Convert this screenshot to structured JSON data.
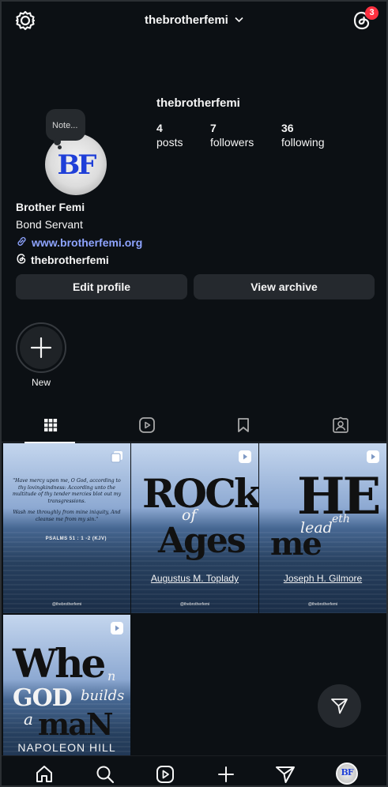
{
  "header": {
    "username": "thebrotherfemi",
    "notification_count": "3"
  },
  "note": {
    "text": "Note..."
  },
  "avatar": {
    "initials": "BF"
  },
  "profile": {
    "handle": "thebrotherfemi",
    "stats": [
      {
        "value": "4",
        "label": "posts"
      },
      {
        "value": "7",
        "label": "followers"
      },
      {
        "value": "36",
        "label": "following"
      }
    ],
    "display_name": "Brother Femi",
    "bio": "Bond Servant",
    "link": "www.brotherfemi.org",
    "threads_handle": "thebrotherfemi"
  },
  "actions": {
    "edit_profile": "Edit profile",
    "view_archive": "View archive"
  },
  "highlights": {
    "new_label": "New"
  },
  "posts": [
    {
      "type": "carousel",
      "quote_1": "\"Have mercy upon me, O God, according to thy lovingkindness: According unto the multitude of thy tender mercies blot out my transgressions.",
      "quote_2": "Wash me throughly from mine iniquity, And cleanse me from my sin.\"",
      "reference": "PSALMS 51 : 1 -2 (KJV)",
      "watermark": "@thebrotherfemi"
    },
    {
      "type": "reel",
      "title_1": "ROCk",
      "title_of": "of",
      "title_2": "Ages",
      "author": "Augustus M. Toplady",
      "watermark": "@thebrotherfemi"
    },
    {
      "type": "reel",
      "title_1": "HE",
      "title_lead": "lead",
      "title_eth": "eth",
      "title_2": "me",
      "author": "Joseph H. Gilmore",
      "watermark": "@thebrotherfemi"
    },
    {
      "type": "reel",
      "title_1": "Whe",
      "title_n": "n",
      "title_god": "GOD",
      "title_builds": "builds",
      "title_a": "a",
      "title_man": "maN",
      "author": "NAPOLEON HILL"
    }
  ],
  "icons": {
    "settings": "settings-icon",
    "threads": "threads-icon",
    "link": "link-icon",
    "grid": "grid-icon",
    "reels": "reels-icon",
    "saved": "bookmark-icon",
    "tagged": "tagged-icon",
    "home": "home-icon",
    "search": "search-icon",
    "create": "plus-icon",
    "direct": "paper-plane-icon"
  },
  "colors": {
    "background": "#0c1014",
    "button": "#25292e",
    "link": "#8ea4ff",
    "badge": "#ff3040",
    "avatar_text": "#1f3fd8"
  }
}
